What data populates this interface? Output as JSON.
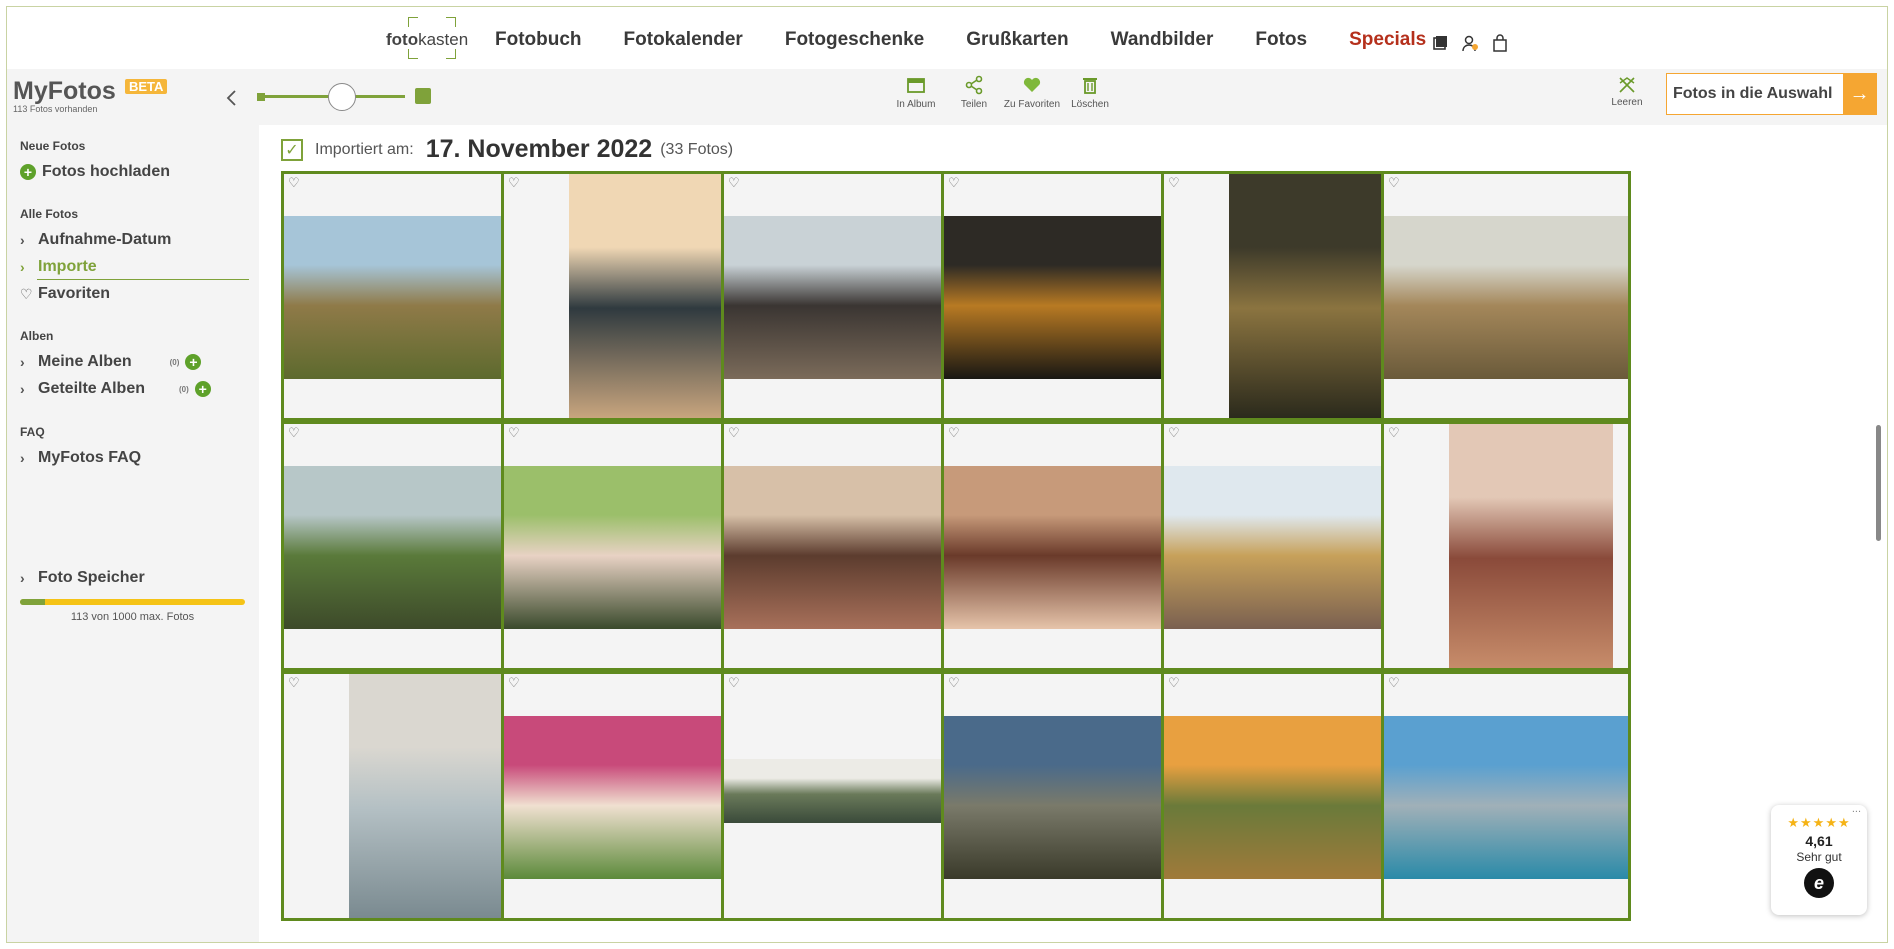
{
  "nav": {
    "logo_bold": "foto",
    "logo_rest": "kasten",
    "links": [
      "Fotobuch",
      "Fotokalender",
      "Fotogeschenke",
      "Grußkarten",
      "Wandbilder",
      "Fotos",
      "Specials"
    ],
    "icons": [
      "photo-stack-icon",
      "user-icon",
      "shopping-bag-icon"
    ]
  },
  "toolbar": {
    "title": "MyFotos",
    "badge": "BETA",
    "subtitle": "113 Fotos vorhanden",
    "zoom_level": 0.55,
    "actions": [
      {
        "label": "In Album",
        "icon": "album-icon"
      },
      {
        "label": "Teilen",
        "icon": "share-icon"
      },
      {
        "label": "Zu Favoriten",
        "icon": "heart-icon"
      },
      {
        "label": "Löschen",
        "icon": "trash-icon"
      }
    ],
    "clear_label": "Leeren",
    "selection_button": "Fotos in die Auswahl",
    "selection_arrow": "→"
  },
  "sidebar": {
    "sections": {
      "neue": "Neue Fotos",
      "alle": "Alle Fotos",
      "alben": "Alben",
      "faq": "FAQ"
    },
    "upload": "Fotos hochladen",
    "aufnahme": "Aufnahme-Datum",
    "importe": "Importe",
    "favoriten": "Favoriten",
    "meine_alben": "Meine Alben",
    "meine_alben_count": "(0)",
    "geteilte_alben": "Geteilte Alben",
    "geteilte_alben_count": "(0)",
    "faq_item": "MyFotos FAQ",
    "speicher": "Foto Speicher",
    "speicher_used": 113,
    "speicher_max": 1000,
    "speicher_text": "113 von 1000 max. Fotos"
  },
  "main": {
    "import_label": "Importiert am:",
    "import_date": "17. November 2022",
    "import_count": "(33 Fotos)",
    "rows": [
      [
        {
          "left": "1",
          "right": "1",
          "orient": "land",
          "colors": [
            "#a6c5d8",
            "#8f7a48",
            "#5d6a2e"
          ]
        },
        {
          "left": "2",
          "right": "2",
          "orient": "port",
          "colors": [
            "#f0d7b4",
            "#2f3a3f",
            "#c8a57e"
          ]
        },
        {
          "left": "3",
          "right": "3",
          "orient": "land",
          "colors": [
            "#c9d2d6",
            "#3a3532",
            "#7b6b5a"
          ]
        },
        {
          "left": "4",
          "right": "4",
          "orient": "land",
          "colors": [
            "#2d2a25",
            "#b87a23",
            "#181713"
          ]
        },
        {
          "left": "5",
          "right": "5",
          "orient": "port",
          "colors": [
            "#3d3a2a",
            "#8b7440",
            "#2b2a1c"
          ]
        },
        {
          "left": "7",
          "right": "6",
          "orient": "land",
          "colors": [
            "#d6d6cc",
            "#a4875a",
            "#6a5a3a"
          ]
        }
      ],
      [
        {
          "left": "6",
          "right": "7",
          "orient": "land",
          "colors": [
            "#b7c7c8",
            "#5a7a3a",
            "#3d4a2a"
          ]
        },
        {
          "left": "8",
          "right": "8",
          "orient": "land",
          "colors": [
            "#9bbf6a",
            "#e8d2c4",
            "#3a4a2c"
          ]
        },
        {
          "left": "9",
          "right": "9",
          "orient": "land",
          "colors": [
            "#d7c0a8",
            "#5c3c2e",
            "#a8705a"
          ]
        },
        {
          "left": "10",
          "right": "10",
          "orient": "land",
          "colors": [
            "#c79a7a",
            "#6a3a2a",
            "#e6c4aa"
          ]
        },
        {
          "left": "11",
          "right": "11",
          "orient": "land",
          "colors": [
            "#dfe8ee",
            "#c7a15a",
            "#7a6050"
          ]
        },
        {
          "left": "12",
          "right": "12",
          "orient": "port",
          "colors": [
            "#e3c8b6",
            "#8a4a3a",
            "#c78c6a"
          ]
        }
      ],
      [
        {
          "left": "",
          "right": "",
          "orient": "port",
          "colors": [
            "#dad7d0",
            "#b4c0c4",
            "#7a8a90"
          ]
        },
        {
          "left": "",
          "right": "",
          "orient": "land",
          "colors": [
            "#c84a7a",
            "#f0e0d0",
            "#5c8a3a"
          ]
        },
        {
          "left": "",
          "right": "",
          "orient": "wide",
          "colors": [
            "#ecebe6",
            "#6a7a5a",
            "#3a4a3a"
          ]
        },
        {
          "left": "",
          "right": "",
          "orient": "land",
          "colors": [
            "#4a6a8a",
            "#7a7a6a",
            "#3a3a2a"
          ]
        },
        {
          "left": "",
          "right": "",
          "orient": "land",
          "colors": [
            "#e8a040",
            "#6a7a3a",
            "#a07a3a"
          ]
        },
        {
          "left": "",
          "right": "",
          "orient": "land",
          "colors": [
            "#5aa0d0",
            "#a0b0b8",
            "#2a8aa8"
          ]
        }
      ]
    ]
  },
  "trust": {
    "stars": "★★★★★",
    "rating": "4,61",
    "verdict": "Sehr gut",
    "logo": "e",
    "more": "..."
  },
  "colors": {
    "accent": "#7fa23a",
    "special": "#b5301c",
    "orange": "#f5a632"
  }
}
